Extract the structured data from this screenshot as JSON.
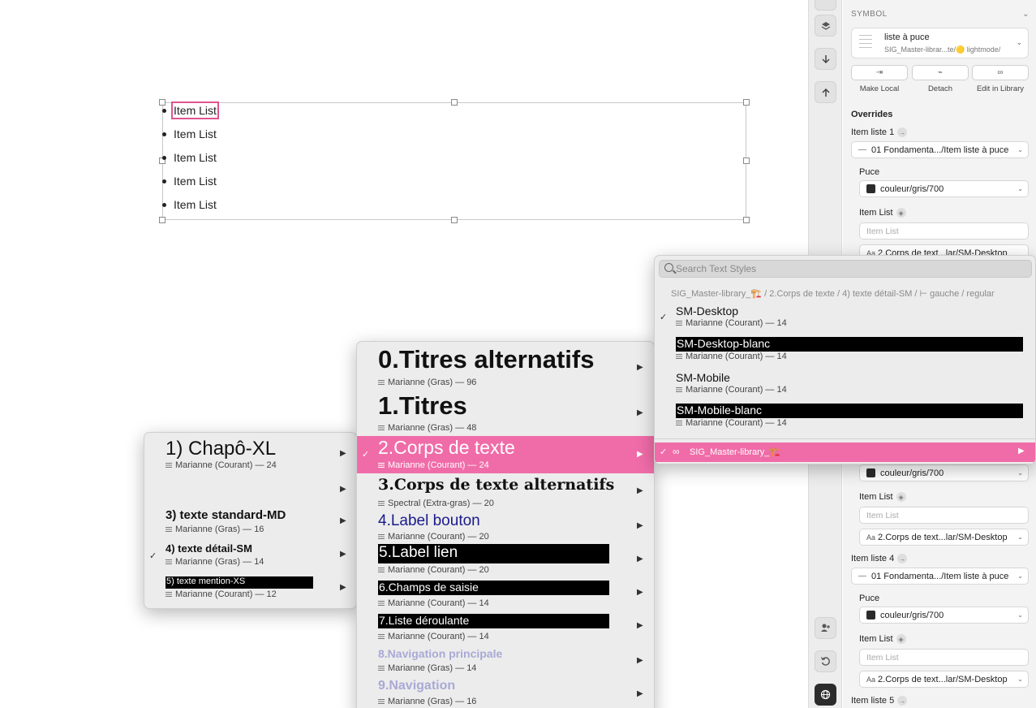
{
  "canvas": {
    "items": [
      "Item List",
      "Item List",
      "Item List",
      "Item List",
      "Item List"
    ]
  },
  "inspector": {
    "section": "SYMBOL",
    "symbol_name": "liste à puce",
    "symbol_path": "SIG_Master-librar...te/🟡 lightmode/",
    "actions": [
      "Make Local",
      "Detach",
      "Edit in Library"
    ],
    "overrides_title": "Overrides",
    "item1": {
      "label": "Item liste 1",
      "symbol": "01 Fondamenta.../Item liste à puce",
      "puce_label": "Puce",
      "puce_value": "couleur/gris/700",
      "itemlist_label": "Item List",
      "itemlist_placeholder": "Item List",
      "style_value": "2.Corps de text...lar/SM-Desktop"
    },
    "item3": {
      "puce_value": "couleur/gris/700",
      "itemlist_label": "Item List",
      "itemlist_placeholder": "Item List",
      "style_value": "2.Corps de text...lar/SM-Desktop"
    },
    "item4": {
      "label": "Item liste 4",
      "symbol": "01 Fondamenta.../Item liste à puce",
      "puce_label": "Puce",
      "puce_value": "couleur/gris/700",
      "itemlist_label": "Item List",
      "itemlist_placeholder": "Item List",
      "style_value": "2.Corps de text...lar/SM-Desktop"
    },
    "item5_label": "Item liste 5"
  },
  "menu_left": {
    "items": [
      {
        "title": "1) Chapô-XL",
        "sub": "Marianne (Courant) — 24"
      },
      {
        "title": "",
        "sub": ""
      },
      {
        "title": "3) texte standard-MD",
        "sub": "Marianne (Gras) — 16"
      },
      {
        "title": "4) texte détail-SM",
        "sub": "Marianne (Gras) — 14"
      },
      {
        "title": "5) texte mention-XS",
        "sub": "Marianne (Courant) — 12"
      }
    ]
  },
  "menu_mid": {
    "items": [
      {
        "title": "0.Titres alternatifs",
        "sub": "Marianne (Gras) — 96"
      },
      {
        "title": "1.Titres",
        "sub": "Marianne (Gras) — 48"
      },
      {
        "title": "2.Corps de texte",
        "sub": "Marianne (Courant) — 24"
      },
      {
        "title": "3.Corps de texte alternatifs",
        "sub": "Spectral (Extra-gras) — 20"
      },
      {
        "title": "4.Label bouton",
        "sub": "Marianne (Courant) — 20"
      },
      {
        "title": "5.Label lien",
        "sub": "Marianne (Courant) — 20"
      },
      {
        "title": "6.Champs de saisie",
        "sub": "Marianne (Courant) — 14"
      },
      {
        "title": "7.Liste déroulante",
        "sub": "Marianne (Courant) — 14"
      },
      {
        "title": "8.Navigation principale",
        "sub": "Marianne (Gras) — 14"
      },
      {
        "title": "9.Navigation",
        "sub": "Marianne (Gras) — 16"
      }
    ]
  },
  "menu_right": {
    "search_placeholder": "Search Text Styles",
    "breadcrumb": "SIG_Master-library_🏗️ / 2.Corps de texte / 4) texte détail-SM / ⊢ gauche / regular",
    "items": [
      {
        "title": "SM-Desktop",
        "sub": "Marianne (Courant) — 14"
      },
      {
        "title": "SM-Desktop-blanc",
        "sub": "Marianne (Courant) — 14"
      },
      {
        "title": "SM-Mobile",
        "sub": "Marianne (Courant) — 14"
      },
      {
        "title": "SM-Mobile-blanc",
        "sub": "Marianne (Courant) — 14"
      }
    ],
    "library": "SIG_Master-library_🏗️"
  },
  "colors": {
    "accent": "#f06ca8",
    "selection_outline": "#e0558e",
    "label_blue": "#1a1a8c",
    "nav_lilac": "#a9a9d6"
  }
}
